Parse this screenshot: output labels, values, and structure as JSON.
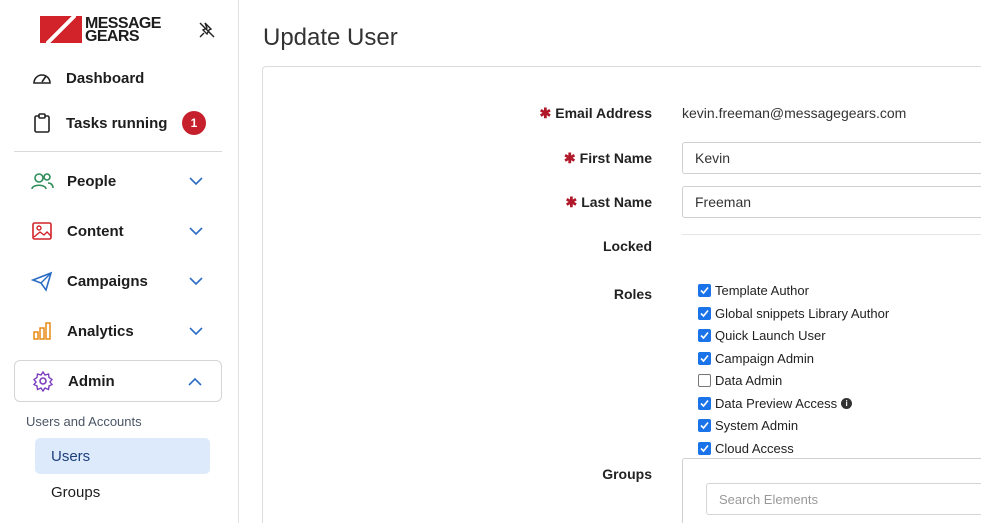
{
  "logo": {
    "line1": "MESSAGE",
    "line2": "GEARS"
  },
  "nav": {
    "dashboard": "Dashboard",
    "tasks": "Tasks running",
    "tasks_badge": "1",
    "people": "People",
    "content": "Content",
    "campaigns": "Campaigns",
    "analytics": "Analytics",
    "admin": "Admin",
    "admin_subhead": "Users and Accounts",
    "users": "Users",
    "groups": "Groups"
  },
  "page": {
    "title": "Update User"
  },
  "form": {
    "email_label": "Email Address",
    "email_value": "kevin.freeman@messagegears.com",
    "first_label": "First Name",
    "first_value": "Kevin",
    "last_label": "Last Name",
    "last_value": "Freeman",
    "locked_label": "Locked",
    "roles_label": "Roles",
    "groups_label": "Groups",
    "search_placeholder": "Search Elements",
    "required_mark": "✱"
  },
  "roles": [
    {
      "label": "Template Author",
      "checked": true
    },
    {
      "label": "Global snippets Library Author",
      "checked": true
    },
    {
      "label": "Quick Launch User",
      "checked": true
    },
    {
      "label": "Campaign Admin",
      "checked": true
    },
    {
      "label": "Data Admin",
      "checked": false
    },
    {
      "label": "Data Preview Access",
      "checked": true
    },
    {
      "label": "System Admin",
      "checked": true
    },
    {
      "label": "Cloud Access",
      "checked": true
    }
  ],
  "colors": {
    "brand": "#d2232a",
    "accent": "#1a73e8",
    "selected_bg": "#dceafb",
    "badge": "#c5202b"
  }
}
